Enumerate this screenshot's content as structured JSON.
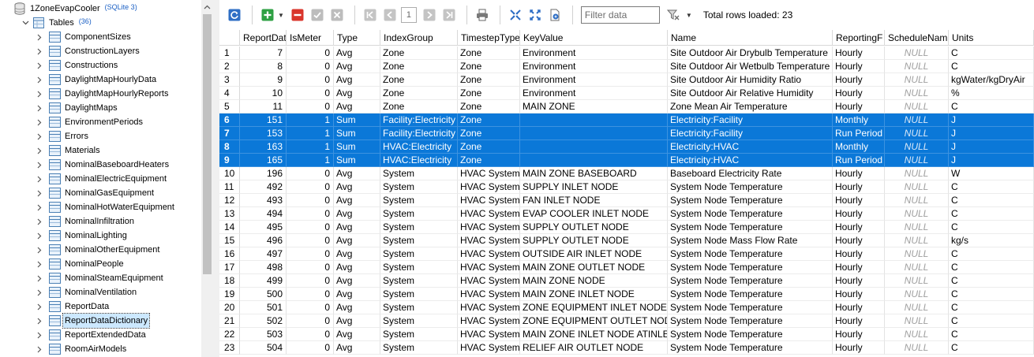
{
  "tree": {
    "db": {
      "name": "1ZoneEvapCooler",
      "type": "(SQLite 3)"
    },
    "tables_node": {
      "label": "Tables",
      "count": "(36)"
    },
    "tables": [
      "ComponentSizes",
      "ConstructionLayers",
      "Constructions",
      "DaylightMapHourlyData",
      "DaylightMapHourlyReports",
      "DaylightMaps",
      "EnvironmentPeriods",
      "Errors",
      "Materials",
      "NominalBaseboardHeaters",
      "NominalElectricEquipment",
      "NominalGasEquipment",
      "NominalHotWaterEquipment",
      "NominalInfiltration",
      "NominalLighting",
      "NominalOtherEquipment",
      "NominalPeople",
      "NominalSteamEquipment",
      "NominalVentilation",
      "ReportData",
      "ReportDataDictionary",
      "ReportExtendedData",
      "RoomAirModels"
    ],
    "selected_table": "ReportDataDictionary"
  },
  "toolbar": {
    "page_number": "1",
    "filter_placeholder": "Filter data",
    "total_rows": "Total rows loaded: 23"
  },
  "grid": {
    "columns": [
      "ReportDat",
      "IsMeter",
      "Type",
      "IndexGroup",
      "TimestepType",
      "KeyValue",
      "Name",
      "ReportingF",
      "ScheduleNam",
      "Units"
    ],
    "rows": [
      [
        "1",
        "7",
        "0",
        "Avg",
        "Zone",
        "Zone",
        "Environment",
        "Site Outdoor Air Drybulb Temperature",
        "Hourly",
        "NULL",
        "C"
      ],
      [
        "2",
        "8",
        "0",
        "Avg",
        "Zone",
        "Zone",
        "Environment",
        "Site Outdoor Air Wetbulb Temperature",
        "Hourly",
        "NULL",
        "C"
      ],
      [
        "3",
        "9",
        "0",
        "Avg",
        "Zone",
        "Zone",
        "Environment",
        "Site Outdoor Air Humidity Ratio",
        "Hourly",
        "NULL",
        "kgWater/kgDryAir"
      ],
      [
        "4",
        "10",
        "0",
        "Avg",
        "Zone",
        "Zone",
        "Environment",
        "Site Outdoor Air Relative Humidity",
        "Hourly",
        "NULL",
        "%"
      ],
      [
        "5",
        "11",
        "0",
        "Avg",
        "Zone",
        "Zone",
        "MAIN ZONE",
        "Zone Mean Air Temperature",
        "Hourly",
        "NULL",
        "C"
      ],
      [
        "6",
        "151",
        "1",
        "Sum",
        "Facility:Electricity",
        "Zone",
        "",
        "Electricity:Facility",
        "Monthly",
        "NULL",
        "J"
      ],
      [
        "7",
        "153",
        "1",
        "Sum",
        "Facility:Electricity",
        "Zone",
        "",
        "Electricity:Facility",
        "Run Period",
        "NULL",
        "J"
      ],
      [
        "8",
        "163",
        "1",
        "Sum",
        "HVAC:Electricity",
        "Zone",
        "",
        "Electricity:HVAC",
        "Monthly",
        "NULL",
        "J"
      ],
      [
        "9",
        "165",
        "1",
        "Sum",
        "HVAC:Electricity",
        "Zone",
        "",
        "Electricity:HVAC",
        "Run Period",
        "NULL",
        "J"
      ],
      [
        "10",
        "196",
        "0",
        "Avg",
        "System",
        "HVAC System",
        "MAIN ZONE BASEBOARD",
        "Baseboard Electricity Rate",
        "Hourly",
        "NULL",
        "W"
      ],
      [
        "11",
        "492",
        "0",
        "Avg",
        "System",
        "HVAC System",
        "SUPPLY INLET NODE",
        "System Node Temperature",
        "Hourly",
        "NULL",
        "C"
      ],
      [
        "12",
        "493",
        "0",
        "Avg",
        "System",
        "HVAC System",
        "FAN INLET NODE",
        "System Node Temperature",
        "Hourly",
        "NULL",
        "C"
      ],
      [
        "13",
        "494",
        "0",
        "Avg",
        "System",
        "HVAC System",
        "EVAP COOLER INLET NODE",
        "System Node Temperature",
        "Hourly",
        "NULL",
        "C"
      ],
      [
        "14",
        "495",
        "0",
        "Avg",
        "System",
        "HVAC System",
        "SUPPLY OUTLET NODE",
        "System Node Temperature",
        "Hourly",
        "NULL",
        "C"
      ],
      [
        "15",
        "496",
        "0",
        "Avg",
        "System",
        "HVAC System",
        "SUPPLY OUTLET NODE",
        "System Node Mass Flow Rate",
        "Hourly",
        "NULL",
        "kg/s"
      ],
      [
        "16",
        "497",
        "0",
        "Avg",
        "System",
        "HVAC System",
        "OUTSIDE AIR INLET NODE",
        "System Node Temperature",
        "Hourly",
        "NULL",
        "C"
      ],
      [
        "17",
        "498",
        "0",
        "Avg",
        "System",
        "HVAC System",
        "MAIN ZONE OUTLET NODE",
        "System Node Temperature",
        "Hourly",
        "NULL",
        "C"
      ],
      [
        "18",
        "499",
        "0",
        "Avg",
        "System",
        "HVAC System",
        "MAIN ZONE NODE",
        "System Node Temperature",
        "Hourly",
        "NULL",
        "C"
      ],
      [
        "19",
        "500",
        "0",
        "Avg",
        "System",
        "HVAC System",
        "MAIN ZONE INLET NODE",
        "System Node Temperature",
        "Hourly",
        "NULL",
        "C"
      ],
      [
        "20",
        "501",
        "0",
        "Avg",
        "System",
        "HVAC System",
        "ZONE EQUIPMENT INLET NODE",
        "System Node Temperature",
        "Hourly",
        "NULL",
        "C"
      ],
      [
        "21",
        "502",
        "0",
        "Avg",
        "System",
        "HVAC System",
        "ZONE EQUIPMENT OUTLET NODE",
        "System Node Temperature",
        "Hourly",
        "NULL",
        "C"
      ],
      [
        "22",
        "503",
        "0",
        "Avg",
        "System",
        "HVAC System",
        "MAIN ZONE INLET NODE ATINLET",
        "System Node Temperature",
        "Hourly",
        "NULL",
        "C"
      ],
      [
        "23",
        "504",
        "0",
        "Avg",
        "System",
        "HVAC System",
        "RELIEF AIR OUTLET NODE",
        "System Node Temperature",
        "Hourly",
        "NULL",
        "C"
      ]
    ],
    "selected_rows": [
      "6",
      "7",
      "8",
      "9"
    ]
  },
  "colors": {
    "selection": "#0b78d8",
    "null_text": "#a0a0a0",
    "icon_blue": "#4a7fb4"
  },
  "icons": [
    "refresh-icon",
    "add-row-icon",
    "delete-row-icon",
    "commit-icon",
    "rollback-icon",
    "first-page-icon",
    "previous-page-icon",
    "next-page-icon",
    "last-page-icon",
    "print-icon",
    "fit-columns-icon",
    "fit-rows-icon",
    "export-icon",
    "filter-icon"
  ]
}
